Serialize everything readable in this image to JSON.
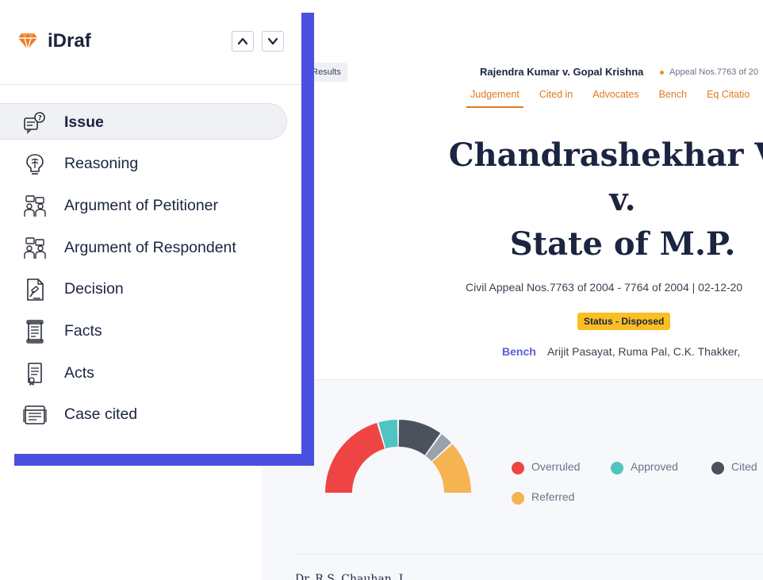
{
  "brand": {
    "name": "iDraf",
    "accent": "#f07a1f"
  },
  "header": {
    "back_label": "o Results",
    "case_title": "Rajendra Kumar v. Gopal Krishna",
    "appeal_short": "Appeal Nos.7763 of 20"
  },
  "tabs": [
    {
      "label": "Judgement",
      "active": true
    },
    {
      "label": "Cited in"
    },
    {
      "label": "Advocates"
    },
    {
      "label": "Bench"
    },
    {
      "label": "Eq Citatio"
    }
  ],
  "hero": {
    "title_line1": "Chandrashekhar Ve",
    "title_line2": "v.",
    "title_line3": "State of M.P.",
    "subtitle": "Civil Appeal Nos.7763 of 2004 - 7764 of 2004 | 02-12-20",
    "status": "Status - Disposed",
    "bench_label": "Bench",
    "bench_names": "Arijit Pasayat, Ruma Pal, C.K. Thakker,"
  },
  "chart_data": {
    "type": "pie",
    "style": "semi-donut",
    "categories": [
      "Overruled",
      "Approved",
      "Cited",
      "",
      "Referred"
    ],
    "values": [
      45,
      10,
      22,
      7,
      26
    ],
    "colors": [
      "#ef4444",
      "#4fc4c1",
      "#4b525d",
      "#9aa1ad",
      "#f6b352"
    ]
  },
  "legend": [
    {
      "label": "Overruled",
      "color": "#ef4444"
    },
    {
      "label": "Approved",
      "color": "#4fc4c1"
    },
    {
      "label": "Cited",
      "color": "#4b525d"
    },
    {
      "label": "Referred",
      "color": "#f6b352"
    }
  ],
  "footer": {
    "partial_name": "Dr. R.S. Chauhan, J."
  },
  "menu": {
    "items": [
      {
        "label": "Issue",
        "icon": "issue-icon",
        "active": true
      },
      {
        "label": "Reasoning",
        "icon": "reasoning-icon"
      },
      {
        "label": "Argument of Petitioner",
        "icon": "petitioner-icon"
      },
      {
        "label": "Argument of Respondent",
        "icon": "respondent-icon"
      },
      {
        "label": "Decision",
        "icon": "decision-icon"
      },
      {
        "label": "Facts",
        "icon": "facts-icon"
      },
      {
        "label": "Acts",
        "icon": "acts-icon"
      },
      {
        "label": "Case cited",
        "icon": "case-cited-icon"
      }
    ]
  }
}
